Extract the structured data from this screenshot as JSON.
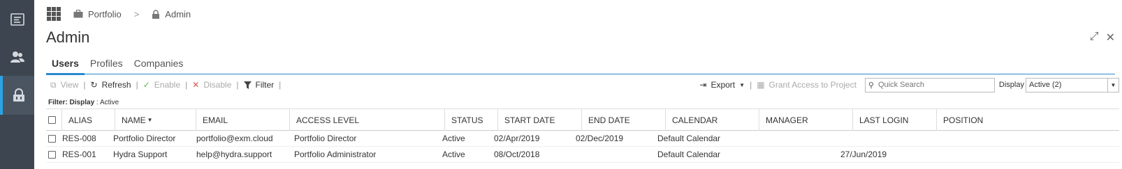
{
  "rail": {
    "items": [
      {
        "icon": "list-icon"
      },
      {
        "icon": "users-icon"
      },
      {
        "icon": "lock-icon",
        "active": true
      }
    ]
  },
  "breadcrumb": {
    "items": [
      {
        "label": "Portfolio",
        "icon": "briefcase-icon"
      },
      {
        "label": "Admin",
        "icon": "lock-icon"
      }
    ],
    "separator": ">"
  },
  "page": {
    "title": "Admin"
  },
  "tabs": [
    {
      "label": "Users",
      "active": true
    },
    {
      "label": "Profiles"
    },
    {
      "label": "Companies"
    }
  ],
  "toolbar": {
    "view": "View",
    "refresh": "Refresh",
    "enable": "Enable",
    "disable": "Disable",
    "filter": "Filter",
    "export": "Export",
    "grant_access": "Grant Access to Project",
    "search_placeholder": "Quick Search",
    "display_label": "Display",
    "display_value": "Active (2)"
  },
  "filter_bar": {
    "label": "Filter: Display",
    "sep": " : ",
    "value": "Active"
  },
  "table": {
    "columns": [
      "ALIAS",
      "NAME",
      "EMAIL",
      "ACCESS LEVEL",
      "STATUS",
      "START DATE",
      "END DATE",
      "CALENDAR",
      "MANAGER",
      "LAST LOGIN",
      "POSITION"
    ],
    "rows": [
      [
        "RES-008",
        "Portfolio Director",
        "portfolio@exm.cloud",
        "Portfolio Director",
        "Active",
        "02/Apr/2019",
        "02/Dec/2019",
        "Default Calendar",
        "",
        "",
        ""
      ],
      [
        "RES-001",
        "Hydra Support",
        "help@hydra.support",
        "Portfolio Administrator",
        "Active",
        "08/Oct/2018",
        "",
        "Default Calendar",
        "",
        "27/Jun/2019",
        ""
      ]
    ]
  },
  "colors": {
    "accent": "#2a87d0",
    "rail": "#3d4650",
    "rail_active": "#2aa4e4"
  }
}
